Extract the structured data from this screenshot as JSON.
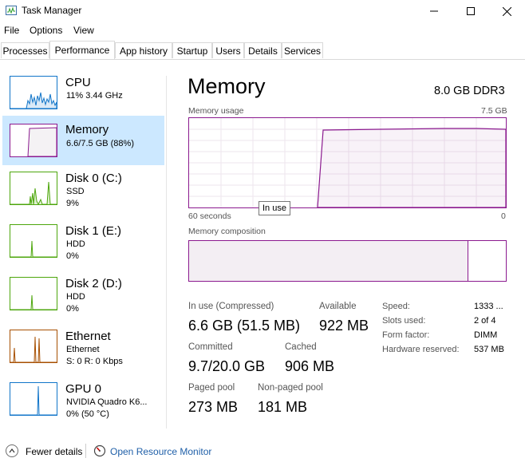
{
  "window": {
    "title": "Task Manager"
  },
  "menu": [
    "File",
    "Options",
    "View"
  ],
  "tabs": [
    "Processes",
    "Performance",
    "App history",
    "Startup",
    "Users",
    "Details",
    "Services"
  ],
  "active_tab": "Performance",
  "sidebar": [
    {
      "title": "CPU",
      "line1": "11% 3.44 GHz",
      "line2": "",
      "line3": ""
    },
    {
      "title": "Memory",
      "line1": "6.6/7.5 GB (88%)",
      "line2": "",
      "line3": ""
    },
    {
      "title": "Disk 0 (C:)",
      "line1": "SSD",
      "line2": "9%",
      "line3": ""
    },
    {
      "title": "Disk 1 (E:)",
      "line1": "HDD",
      "line2": "0%",
      "line3": ""
    },
    {
      "title": "Disk 2 (D:)",
      "line1": "HDD",
      "line2": "0%",
      "line3": ""
    },
    {
      "title": "Ethernet",
      "line1": "Ethernet",
      "line2": "S: 0  R: 0 Kbps",
      "line3": ""
    },
    {
      "title": "GPU 0",
      "line1": "NVIDIA Quadro K6...",
      "line2": "0% (50 °C)",
      "line3": ""
    }
  ],
  "main": {
    "title": "Memory",
    "spec": "8.0 GB DDR3",
    "usage_label": "Memory usage",
    "usage_max": "7.5 GB",
    "time_left": "60 seconds",
    "time_right": "0",
    "tooltip": "In use",
    "composition_label": "Memory composition",
    "composition_in_use_fraction": 0.88,
    "stats": {
      "in_use_label": "In use (Compressed)",
      "in_use_value": "6.6 GB (51.5 MB)",
      "available_label": "Available",
      "available_value": "922 MB",
      "committed_label": "Committed",
      "committed_value": "9.7/20.0 GB",
      "cached_label": "Cached",
      "cached_value": "906 MB",
      "paged_label": "Paged pool",
      "paged_value": "273 MB",
      "nonpaged_label": "Non-paged pool",
      "nonpaged_value": "181 MB"
    },
    "details": [
      {
        "label": "Speed:",
        "value": "1333 ..."
      },
      {
        "label": "Slots used:",
        "value": "2 of 4"
      },
      {
        "label": "Form factor:",
        "value": "DIMM"
      },
      {
        "label": "Hardware reserved:",
        "value": "537 MB"
      }
    ]
  },
  "footer": {
    "fewer_details": "Fewer details",
    "resource_monitor": "Open Resource Monitor"
  },
  "colors": {
    "memory": "#8b1a8f",
    "cpu": "#1175c9",
    "disk": "#4da60c",
    "ethernet": "#a74f01",
    "gpu": "#1175c9",
    "selected": "#cce8ff"
  }
}
